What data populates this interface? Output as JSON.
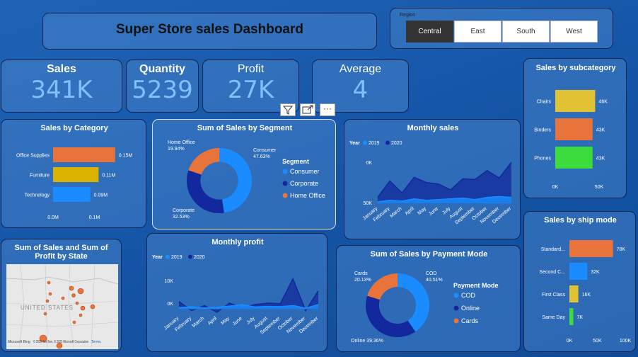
{
  "header": {
    "title": "Super Store sales Dashboard"
  },
  "region": {
    "label": "Region",
    "options": [
      "Central",
      "East",
      "South",
      "West"
    ],
    "selected": "Central"
  },
  "kpis": {
    "sales": {
      "label": "Sales",
      "value": "341K"
    },
    "quantity": {
      "label": "Quantity",
      "value": "5239"
    },
    "profit": {
      "label": "Profit",
      "value": "27K"
    },
    "average": {
      "label": "Average",
      "value": "4"
    }
  },
  "visual_toolbar": {
    "filter_icon": "filter-icon",
    "focus_icon": "focus-mode-icon",
    "more_label": "···"
  },
  "map": {
    "title": "Sum of Sales and Sum of Profit by State",
    "country_label": "UNITED STATES",
    "attribution_left": "Microsoft Bing",
    "attribution": "© 2025 TomTom, © 2025 Microsoft Corporation",
    "terms": "Terms"
  },
  "colors": {
    "orange": "#e8743b",
    "yellow": "#d9b300",
    "blue": "#1a8cff",
    "navy": "#13289c",
    "green": "#3ddc3d"
  },
  "chart_data": [
    {
      "id": "sales_by_category",
      "type": "bar",
      "title": "Sales by Category",
      "categories": [
        "Office Supplies",
        "Furniture",
        "Technology"
      ],
      "values": [
        0.15,
        0.11,
        0.09
      ],
      "value_labels": [
        "0.15M",
        "0.11M",
        "0.09M"
      ],
      "colors": [
        "#e8743b",
        "#d9b300",
        "#1a8cff"
      ],
      "xticks": [
        "0.0M",
        "0.1M"
      ],
      "xlim": [
        0,
        0.2
      ]
    },
    {
      "id": "sales_by_segment",
      "type": "pie",
      "title": "Sum of Sales by Segment",
      "labels": [
        "Consumer",
        "Corporate",
        "Home Office"
      ],
      "values": [
        47.63,
        32.53,
        19.84
      ],
      "label_pct": [
        "47.63%",
        "32.53%",
        "19.84%"
      ],
      "colors": [
        "#1a8cff",
        "#13289c",
        "#e8743b"
      ],
      "legend_title": "Segment"
    },
    {
      "id": "monthly_sales",
      "type": "area",
      "title": "Monthly sales",
      "legend_title": "Year",
      "series_names": [
        "2019",
        "2020"
      ],
      "categories": [
        "January",
        "February",
        "March",
        "April",
        "May",
        "June",
        "July",
        "August",
        "September",
        "October",
        "November",
        "December"
      ],
      "series": [
        {
          "name": "2019",
          "values": [
            2,
            4,
            3,
            6,
            4,
            5,
            6,
            7,
            5,
            8,
            9,
            8
          ]
        },
        {
          "name": "2020",
          "values": [
            8,
            30,
            14,
            35,
            28,
            26,
            18,
            33,
            32,
            44,
            34,
            55
          ]
        }
      ],
      "yticks": [
        "0K",
        "50K"
      ],
      "ylim": [
        0,
        60
      ],
      "colors": [
        "#1a8cff",
        "#13289c"
      ]
    },
    {
      "id": "monthly_profit",
      "type": "area",
      "title": "Monthly profit",
      "legend_title": "Year",
      "series_names": [
        "2019",
        "2020"
      ],
      "categories": [
        "January",
        "February",
        "March",
        "April",
        "May",
        "June",
        "July",
        "August",
        "September",
        "October",
        "November",
        "December"
      ],
      "series": [
        {
          "name": "2019",
          "values": [
            0.5,
            0.8,
            0.4,
            0.6,
            1.0,
            1.5,
            0.7,
            0.9,
            0.8,
            1.2,
            0.3,
            1.5
          ]
        },
        {
          "name": "2020",
          "values": [
            2.5,
            -0.5,
            1.2,
            -1.0,
            2.0,
            0.5,
            1.5,
            2.0,
            1.8,
            10.0,
            -0.5,
            6.0
          ]
        }
      ],
      "yticks": [
        "10K",
        "0K"
      ],
      "ylim": [
        -2,
        12
      ],
      "colors": [
        "#1a8cff",
        "#13289c"
      ]
    },
    {
      "id": "sales_by_payment",
      "type": "pie",
      "title": "Sum of Sales by Payment Mode",
      "labels": [
        "COD",
        "Online",
        "Cards"
      ],
      "values": [
        40.51,
        39.36,
        20.13
      ],
      "label_pct": [
        "40.51%",
        "39.36%",
        "20.13%"
      ],
      "colors": [
        "#1a8cff",
        "#13289c",
        "#e8743b"
      ],
      "legend_title": "Payment Mode"
    },
    {
      "id": "sales_by_subcategory",
      "type": "bar",
      "title": "Sales by subcategory",
      "categories": [
        "Chairs",
        "Binders",
        "Phones"
      ],
      "values": [
        46,
        43,
        43
      ],
      "value_labels": [
        "46K",
        "43K",
        "43K"
      ],
      "colors": [
        "#e0c232",
        "#e8743b",
        "#3ddc3d"
      ],
      "xticks": [
        "0K",
        "50K"
      ],
      "xlim": [
        0,
        75
      ]
    },
    {
      "id": "sales_by_ship_mode",
      "type": "bar",
      "title": "Sales by ship mode",
      "categories": [
        "Standard...",
        "Second C...",
        "First Class",
        "Same Day"
      ],
      "values": [
        78,
        32,
        16,
        7
      ],
      "value_labels": [
        "78K",
        "32K",
        "16K",
        "7K"
      ],
      "colors": [
        "#e8743b",
        "#1a8cff",
        "#e0c232",
        "#3ddc3d"
      ],
      "xticks": [
        "0K",
        "50K",
        "100K"
      ],
      "xlim": [
        0,
        100
      ]
    }
  ]
}
